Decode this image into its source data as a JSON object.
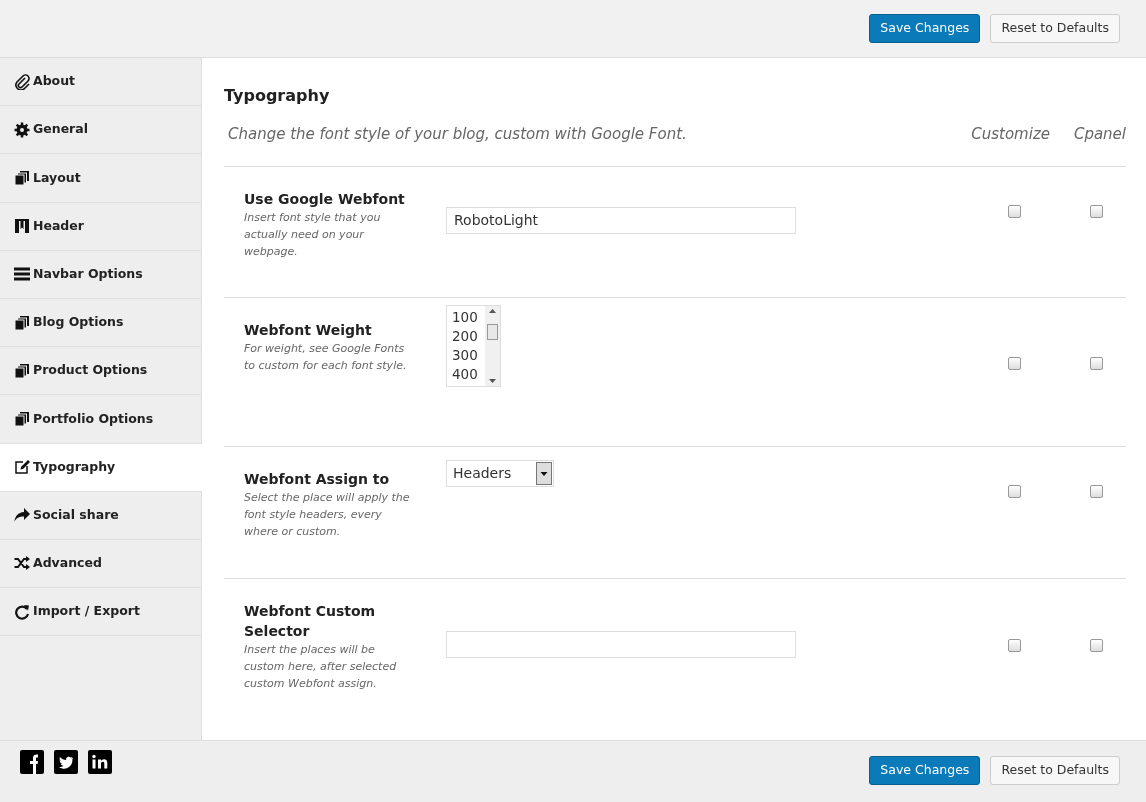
{
  "top_buttons": [
    {
      "label": "Save Changes",
      "kind": "primary"
    },
    {
      "label": "Reset to Defaults",
      "kind": "secondary"
    }
  ],
  "sidebar": {
    "items": [
      {
        "label": "About",
        "selected": false
      },
      {
        "label": "General",
        "selected": false
      },
      {
        "label": "Layout",
        "selected": false
      },
      {
        "label": "Header",
        "selected": false
      },
      {
        "label": "Navbar Options",
        "selected": false
      },
      {
        "label": "Blog Options",
        "selected": false
      },
      {
        "label": "Product Options",
        "selected": false
      },
      {
        "label": "Portfolio Options",
        "selected": false
      },
      {
        "label": "Typography",
        "selected": true
      },
      {
        "label": "Social share",
        "selected": false
      },
      {
        "label": "Advanced",
        "selected": false
      },
      {
        "label": "Import / Export",
        "selected": false
      }
    ]
  },
  "section": {
    "title": "Typography",
    "subtitle": "Change the font style of your blog, custom with Google Font.",
    "columns": [
      "Customize",
      "Cpanel"
    ],
    "options": [
      {
        "label": "Use Google Webfont",
        "description": "Insert font style that you actually need on your webpage.",
        "kind": "text",
        "value": "RobotoLight",
        "customize": false,
        "cpanel": false
      },
      {
        "label": "Webfont Weight",
        "description": "For weight, see Google Fonts to custom for each font style.",
        "kind": "listbox",
        "items": [
          "100",
          "200",
          "300",
          "400"
        ],
        "customize": false,
        "cpanel": false
      },
      {
        "label": "Webfont Assign to",
        "description": "Select the place will apply the font style headers, every where or custom.",
        "kind": "select",
        "value": "Headers",
        "customize": false,
        "cpanel": false
      },
      {
        "label": "Webfont Custom Selector",
        "description": "Insert the places will be custom here, after selected custom Webfont assign.",
        "kind": "text",
        "customize": false,
        "cpanel": false
      }
    ]
  },
  "bottom_buttons": [
    {
      "label": "Save Changes",
      "kind": "primary"
    },
    {
      "label": "Reset to Defaults",
      "kind": "secondary"
    }
  ]
}
